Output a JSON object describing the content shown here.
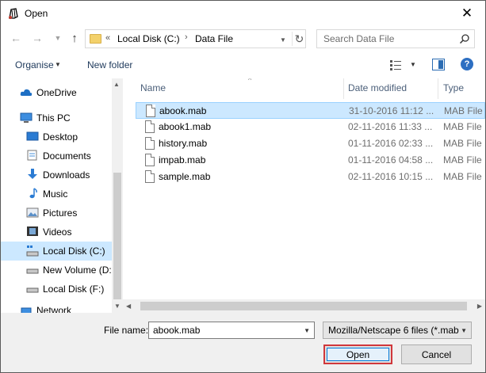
{
  "window": {
    "title": "Open"
  },
  "nav": {
    "address_crumbs": [
      "Local Disk (C:)",
      "Data File"
    ],
    "address_prefix": "«",
    "search_placeholder": "Search Data File"
  },
  "toolbar": {
    "organise_label": "Organise",
    "new_folder_label": "New folder"
  },
  "sidebar": {
    "items": [
      {
        "label": "OneDrive",
        "icon": "cloud-icon"
      },
      {
        "label": "This PC",
        "icon": "computer-icon"
      },
      {
        "label": "Desktop",
        "icon": "desktop-icon"
      },
      {
        "label": "Documents",
        "icon": "documents-icon"
      },
      {
        "label": "Downloads",
        "icon": "downloads-icon"
      },
      {
        "label": "Music",
        "icon": "music-icon"
      },
      {
        "label": "Pictures",
        "icon": "pictures-icon"
      },
      {
        "label": "Videos",
        "icon": "videos-icon"
      },
      {
        "label": "Local Disk (C:)",
        "icon": "drive-icon",
        "selected": true
      },
      {
        "label": "New Volume (D:",
        "icon": "drive-icon"
      },
      {
        "label": "Local Disk (F:)",
        "icon": "drive-icon"
      },
      {
        "label": "Network",
        "icon": "network-icon"
      }
    ]
  },
  "file_list": {
    "columns": [
      "Name",
      "Date modified",
      "Type"
    ],
    "rows": [
      {
        "name": "abook.mab",
        "date": "31-10-2016 11:12 ...",
        "type": "MAB File",
        "selected": true
      },
      {
        "name": "abook1.mab",
        "date": "02-11-2016 11:33 ...",
        "type": "MAB File"
      },
      {
        "name": "history.mab",
        "date": "01-11-2016 02:33 ...",
        "type": "MAB File"
      },
      {
        "name": "impab.mab",
        "date": "01-11-2016 04:58 ...",
        "type": "MAB File"
      },
      {
        "name": "sample.mab",
        "date": "02-11-2016 10:15 ...",
        "type": "MAB File"
      }
    ]
  },
  "bottom": {
    "file_name_label": "File name:",
    "file_name_value": "abook.mab",
    "filter_value": "Mozilla/Netscape 6 files (*.mab",
    "open_label": "Open",
    "cancel_label": "Cancel"
  },
  "colors": {
    "selection": "#cce8ff",
    "highlight_border": "#d0373b",
    "accent": "#0078d7"
  }
}
